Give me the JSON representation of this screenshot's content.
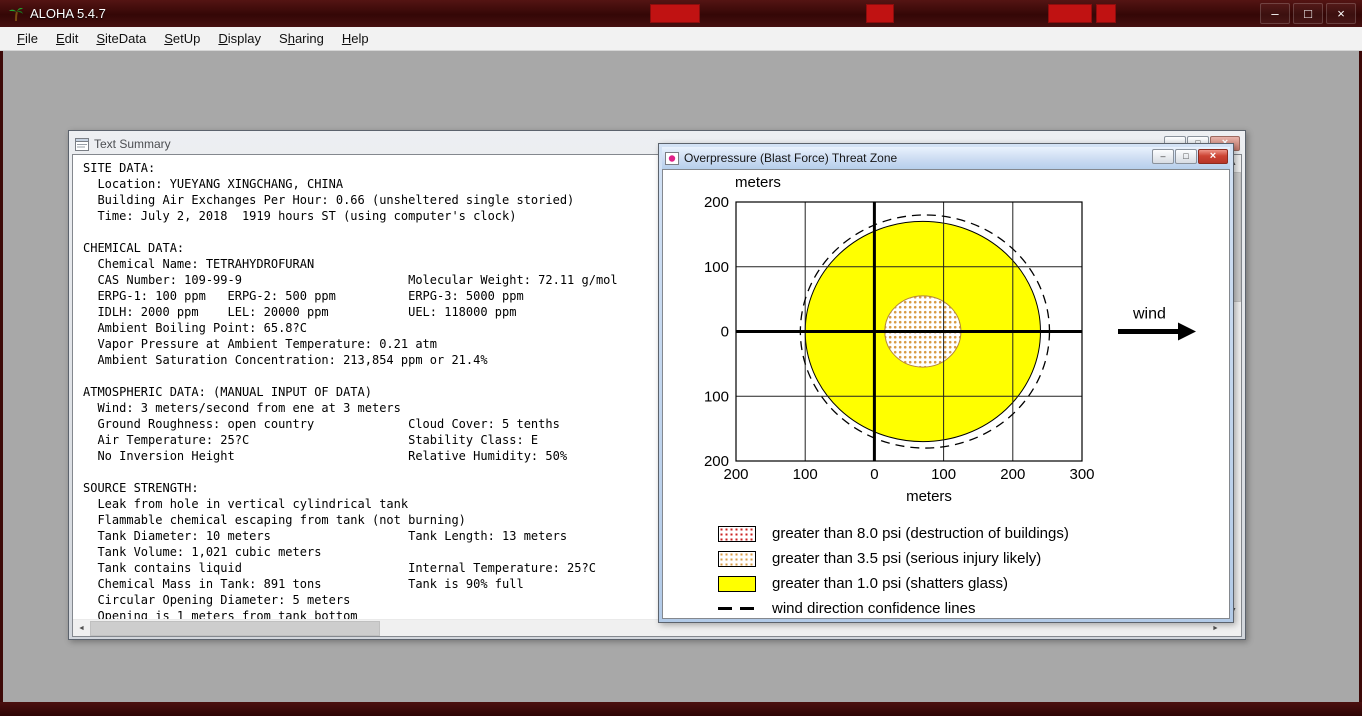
{
  "window": {
    "title": "ALOHA 5.4.7"
  },
  "icons": {
    "minimize": "–",
    "maximize": "□",
    "close": "×",
    "scroll_left": "◄",
    "scroll_right": "►",
    "scroll_up": "▲",
    "scroll_down": "▼"
  },
  "menu": {
    "items": [
      {
        "label": "File",
        "accel": 0
      },
      {
        "label": "Edit",
        "accel": 0
      },
      {
        "label": "SiteData",
        "accel": 0
      },
      {
        "label": "SetUp",
        "accel": 0
      },
      {
        "label": "Display",
        "accel": 0
      },
      {
        "label": "Sharing",
        "accel": 1
      },
      {
        "label": "Help",
        "accel": 0
      }
    ]
  },
  "text_summary_window": {
    "title": "Text Summary",
    "lines": [
      "SITE DATA:",
      "  Location: YUEYANG XINGCHANG, CHINA",
      "  Building Air Exchanges Per Hour: 0.66 (unsheltered single storied)",
      "  Time: July 2, 2018  1919 hours ST (using computer's clock)",
      "",
      "CHEMICAL DATA:",
      "  Chemical Name: TETRAHYDROFURAN",
      "  CAS Number: 109-99-9                       Molecular Weight: 72.11 g/mol",
      "  ERPG-1: 100 ppm   ERPG-2: 500 ppm          ERPG-3: 5000 ppm",
      "  IDLH: 2000 ppm    LEL: 20000 ppm           UEL: 118000 ppm",
      "  Ambient Boiling Point: 65.8?C",
      "  Vapor Pressure at Ambient Temperature: 0.21 atm",
      "  Ambient Saturation Concentration: 213,854 ppm or 21.4%",
      "",
      "ATMOSPHERIC DATA: (MANUAL INPUT OF DATA)",
      "  Wind: 3 meters/second from ene at 3 meters",
      "  Ground Roughness: open country             Cloud Cover: 5 tenths",
      "  Air Temperature: 25?C                      Stability Class: E",
      "  No Inversion Height                        Relative Humidity: 50%",
      "",
      "SOURCE STRENGTH:",
      "  Leak from hole in vertical cylindrical tank",
      "  Flammable chemical escaping from tank (not burning)",
      "  Tank Diameter: 10 meters                   Tank Length: 13 meters",
      "  Tank Volume: 1,021 cubic meters",
      "  Tank contains liquid                       Internal Temperature: 25?C",
      "  Chemical Mass in Tank: 891 tons            Tank is 90% full",
      "  Circular Opening Diameter: 5 meters",
      "  Opening is 1 meters from tank bottom"
    ]
  },
  "overpressure_window": {
    "title": "Overpressure (Blast Force) Threat Zone"
  },
  "chart_data": {
    "type": "threat-zone",
    "title": "Overpressure (Blast Force) Threat Zone",
    "x_axis": {
      "label": "meters",
      "range": [
        -200,
        300
      ],
      "ticks": [
        -200,
        -100,
        0,
        100,
        200,
        300
      ],
      "tick_labels": [
        "200",
        "100",
        "0",
        "100",
        "200",
        "300"
      ]
    },
    "y_axis": {
      "label": "meters",
      "range": [
        -200,
        200
      ],
      "ticks": [
        200,
        100,
        0,
        -100,
        -200
      ],
      "tick_labels": [
        "200",
        "100",
        "0",
        "100",
        "200"
      ]
    },
    "zones": [
      {
        "threshold_psi": 1.0,
        "label": "greater than 1.0 psi (shatters glass)",
        "style": "solid",
        "color": "#ffff00",
        "edge": "#000000",
        "center": [
          70,
          0
        ],
        "radius_m": 170
      },
      {
        "threshold_psi": 3.5,
        "label": "greater than 3.5 psi (serious injury likely)",
        "style": "dots-orange",
        "color": "#d89b44",
        "edge": "#b3873a",
        "center": [
          70,
          0
        ],
        "radius_m": 55
      },
      {
        "threshold_psi": 8.0,
        "label": "greater than 8.0 psi (destruction of buildings)",
        "style": "dots-red",
        "color": "#cc2222",
        "edge": "#aa1111",
        "center": [
          70,
          0
        ],
        "radius_m": 0
      }
    ],
    "confidence_circle": {
      "label": "wind direction confidence lines",
      "center": [
        73,
        0
      ],
      "radius_m": 180,
      "style": "dashed"
    },
    "wind_label": "wind",
    "legend": [
      {
        "swatch": "dots",
        "color": "#cc2222",
        "label": "greater than 8.0 psi (destruction of buildings)"
      },
      {
        "swatch": "dots",
        "color": "#d89b44",
        "label": "greater than 3.5 psi (serious injury likely)"
      },
      {
        "swatch": "solid",
        "color": "#ffff00",
        "label": "greater than 1.0 psi (shatters glass)"
      },
      {
        "swatch": "dashed",
        "color": "#000000",
        "label": "wind direction confidence lines"
      }
    ]
  }
}
